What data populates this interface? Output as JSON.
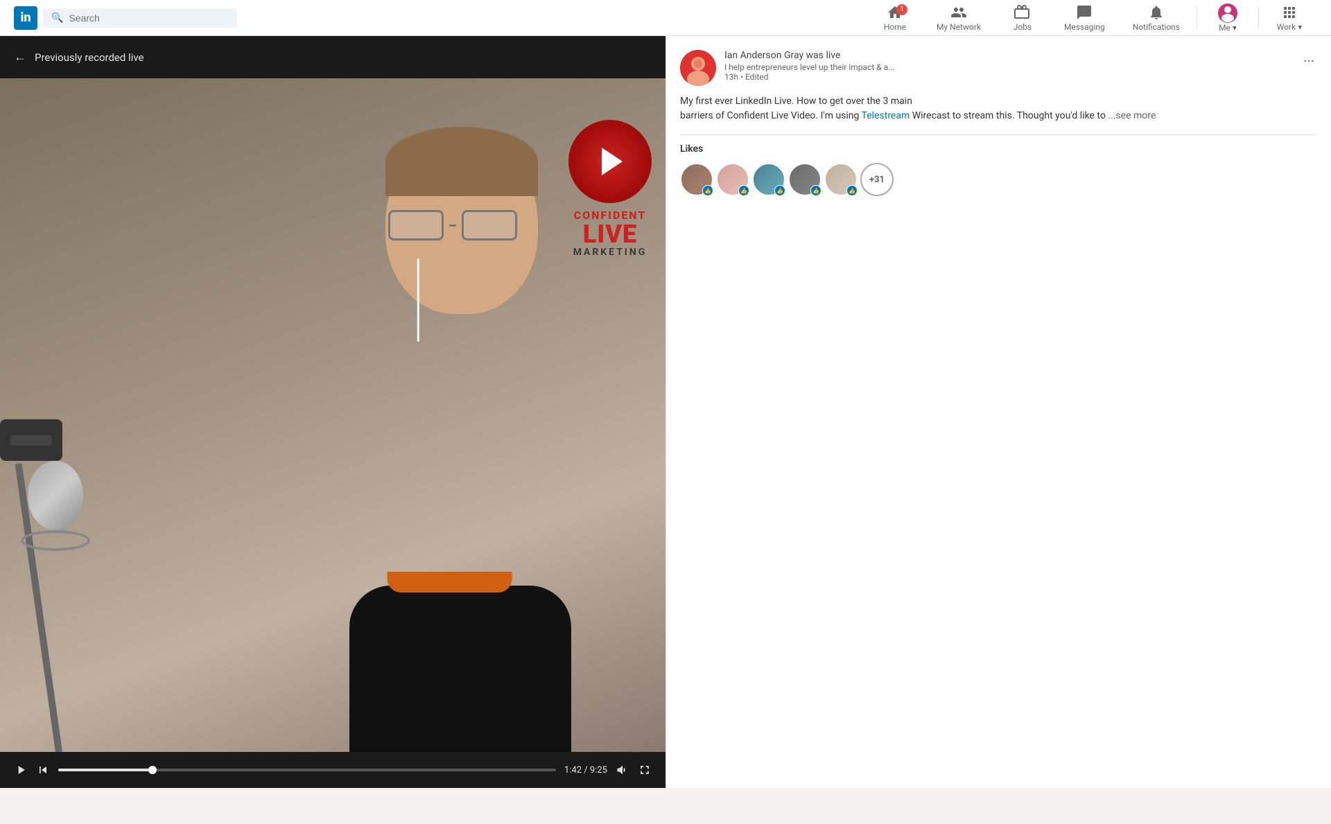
{
  "navbar": {
    "logo": "in",
    "search_placeholder": "Search",
    "nav_items": [
      {
        "id": "home",
        "label": "Home",
        "badge": "1"
      },
      {
        "id": "my-network",
        "label": "My Network",
        "badge": null
      },
      {
        "id": "jobs",
        "label": "Jobs",
        "badge": null
      },
      {
        "id": "messaging",
        "label": "Messaging",
        "badge": null
      },
      {
        "id": "notifications",
        "label": "Notifications",
        "badge": null
      },
      {
        "id": "me",
        "label": "Me",
        "badge": null
      },
      {
        "id": "work",
        "label": "Work",
        "badge": null
      }
    ]
  },
  "video": {
    "back_label": "←",
    "title": "Previously recorded live",
    "current_time": "1:42",
    "total_time": "9:25",
    "progress_pct": 18.9,
    "overlay_text1": "CONFIDENT",
    "overlay_text2": "LIVE",
    "overlay_text3": "MARKETING"
  },
  "post": {
    "poster_name": "Ian Anderson Gray",
    "poster_status": "was live",
    "poster_subtitle": "I help entrepreneurs level up their impact & a...",
    "poster_time": "13h • Edited",
    "content_line1": "My first ever LinkedIn Live. How to get over the 3 main",
    "content_line2": "barriers of Confident Live Video. I'm using ",
    "content_link": "Telestream",
    "content_line3": " Wirecast to stream this. Thought you'd like to",
    "see_more": "...see more",
    "likes_title": "Likes",
    "likes_count": "+31",
    "avatars": [
      {
        "id": "av1",
        "initials": ""
      },
      {
        "id": "av2",
        "initials": ""
      },
      {
        "id": "av3",
        "initials": ""
      },
      {
        "id": "av4",
        "initials": ""
      },
      {
        "id": "av5",
        "initials": ""
      }
    ]
  }
}
